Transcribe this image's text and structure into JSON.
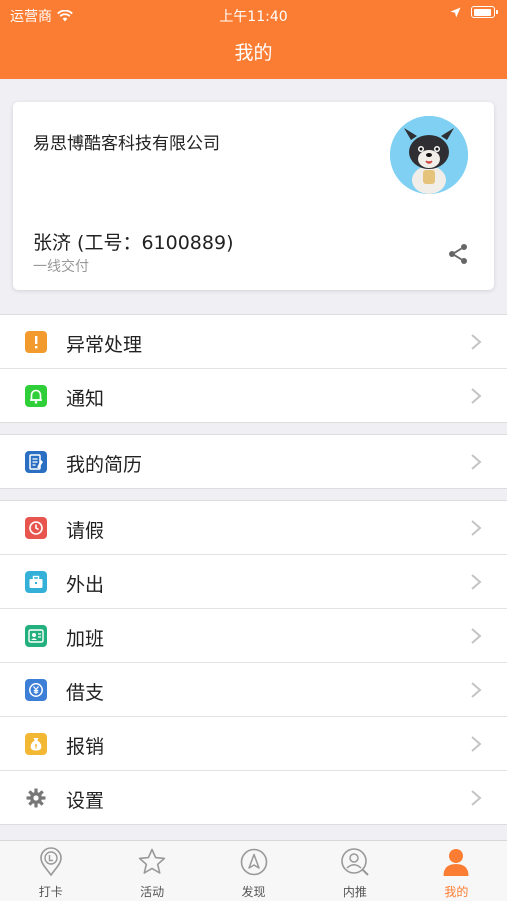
{
  "status_bar": {
    "carrier": "运营商",
    "time": "上午11:40"
  },
  "nav": {
    "title": "我的"
  },
  "profile": {
    "company": "易思博酷客科技有限公司",
    "name_line": "张济 (工号：6100889)",
    "department": "一线交付"
  },
  "menu": {
    "group1": [
      {
        "label": "异常处理",
        "icon": "warning-icon",
        "color": "#f29a2e"
      },
      {
        "label": "通知",
        "icon": "bell-icon",
        "color": "#2fcf3a"
      }
    ],
    "group2": [
      {
        "label": "我的简历",
        "icon": "resume-icon",
        "color": "#2a6fc2"
      }
    ],
    "group3": [
      {
        "label": "请假",
        "icon": "clock-icon",
        "color": "#e8554e"
      },
      {
        "label": "外出",
        "icon": "briefcase-icon",
        "color": "#35b1d9"
      },
      {
        "label": "加班",
        "icon": "overtime-icon",
        "color": "#23b07e"
      },
      {
        "label": "借支",
        "icon": "loan-icon",
        "color": "#3d7fd6"
      },
      {
        "label": "报销",
        "icon": "money-bag-icon",
        "color": "#f2b733"
      },
      {
        "label": "设置",
        "icon": "gear-icon",
        "color": "#777777"
      }
    ]
  },
  "tabs": [
    {
      "label": "打卡",
      "icon": "location-pin-icon"
    },
    {
      "label": "活动",
      "icon": "star-icon"
    },
    {
      "label": "发现",
      "icon": "compass-icon"
    },
    {
      "label": "内推",
      "icon": "user-search-icon"
    },
    {
      "label": "我的",
      "icon": "person-icon",
      "active": true
    }
  ],
  "colors": {
    "accent": "#fb7d33",
    "background": "#efeff4"
  }
}
